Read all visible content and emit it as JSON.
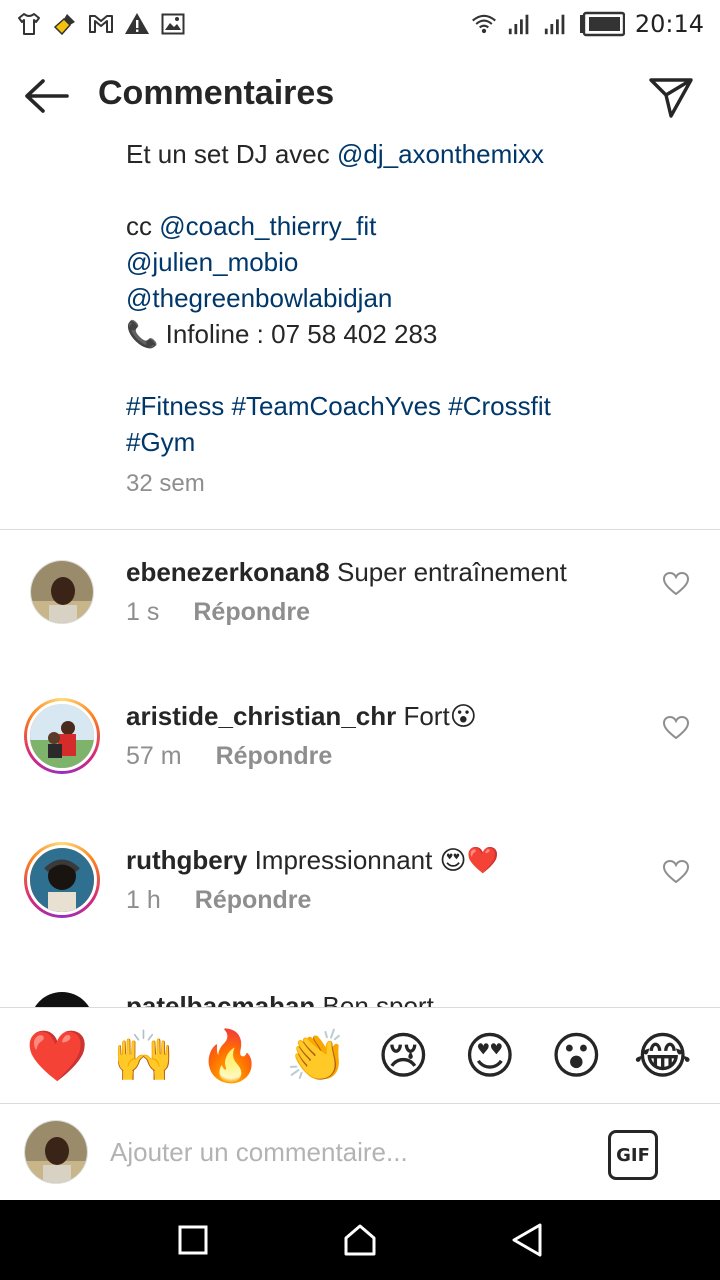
{
  "status_bar": {
    "time": "20:14",
    "left_icons": [
      "tshirt-icon",
      "broom-icon",
      "gmail-icon",
      "warning-icon",
      "image-icon"
    ],
    "right_icons": [
      "wifi-icon",
      "signal-icon",
      "signal-icon-2",
      "battery-icon"
    ]
  },
  "header": {
    "title": "Commentaires",
    "back_icon": "arrow-left-icon",
    "send_icon": "paper-plane-icon"
  },
  "caption": {
    "line1_prefix": "Et un set DJ avec ",
    "line1_mention": "@dj_axonthemixx",
    "line2_prefix": "cc ",
    "line2_mention": "@coach_thierry_fit",
    "line3_mention": "@julien_mobio",
    "line4_mention": "@thegreenbowlabidjan",
    "line5": "📞 Infoline : 07 58 402 283",
    "hashtags_line1": "#Fitness #TeamCoachYves #Crossfit",
    "hashtags_line2": "#Gym",
    "time": "32 sem"
  },
  "comments": [
    {
      "username": "ebenezerkonan8",
      "text": "Super entraînement",
      "time": "1 s",
      "reply_label": "Répondre",
      "has_story": false
    },
    {
      "username": "aristide_christian_chr",
      "text": "Fort😮",
      "time": "57 m",
      "reply_label": "Répondre",
      "has_story": true
    },
    {
      "username": "ruthgbery",
      "text": "Impressionnant 😍❤️",
      "time": "1 h",
      "reply_label": "Répondre",
      "has_story": true
    }
  ],
  "partial_comment": {
    "username": "patelbacmahan",
    "text": "Bon sport"
  },
  "emoji_bar": [
    "❤️",
    "🙌",
    "🔥",
    "👏",
    "😢",
    "😍",
    "😮",
    "😂"
  ],
  "composer": {
    "placeholder": "Ajouter un commentaire...",
    "gif_label": "GIF"
  },
  "nav_bar": {
    "icons": [
      "recents-square-icon",
      "home-icon",
      "back-triangle-icon"
    ]
  },
  "colors": {
    "link": "#00376b",
    "meta": "#8e8e8e",
    "text": "#262626",
    "divider": "#dbdbdb"
  }
}
